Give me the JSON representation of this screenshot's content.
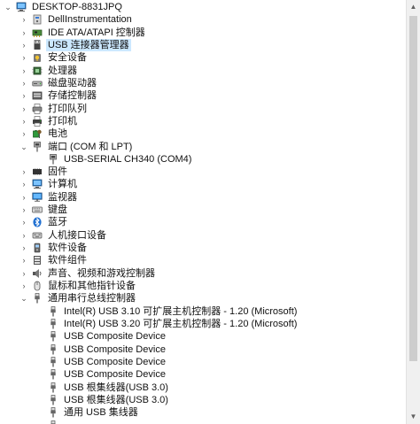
{
  "computer": "DESKTOP-8831JPQ",
  "rows": [
    {
      "label": "DESKTOP-8831JPQ",
      "level": 0,
      "expander": "expanded",
      "icon": "computer-icon"
    },
    {
      "label": "DellInstrumentation",
      "level": 1,
      "expander": "collapsed",
      "icon": "device-icon"
    },
    {
      "label": "IDE ATA/ATAPI 控制器",
      "level": 1,
      "expander": "collapsed",
      "icon": "ide-controller-icon"
    },
    {
      "label": "USB 连接器管理器",
      "level": 1,
      "expander": "collapsed",
      "icon": "usb-connector-icon",
      "selected": true
    },
    {
      "label": "安全设备",
      "level": 1,
      "expander": "collapsed",
      "icon": "security-device-icon"
    },
    {
      "label": "处理器",
      "level": 1,
      "expander": "collapsed",
      "icon": "processor-icon"
    },
    {
      "label": "磁盘驱动器",
      "level": 1,
      "expander": "collapsed",
      "icon": "disk-drive-icon"
    },
    {
      "label": "存储控制器",
      "level": 1,
      "expander": "collapsed",
      "icon": "storage-controller-icon"
    },
    {
      "label": "打印队列",
      "level": 1,
      "expander": "collapsed",
      "icon": "print-queue-icon"
    },
    {
      "label": "打印机",
      "level": 1,
      "expander": "collapsed",
      "icon": "printer-icon"
    },
    {
      "label": "电池",
      "level": 1,
      "expander": "collapsed",
      "icon": "battery-icon"
    },
    {
      "label": "端口 (COM 和 LPT)",
      "level": 1,
      "expander": "expanded",
      "icon": "port-icon"
    },
    {
      "label": "USB-SERIAL CH340 (COM4)",
      "level": 2,
      "expander": "none",
      "icon": "port-icon"
    },
    {
      "label": "固件",
      "level": 1,
      "expander": "collapsed",
      "icon": "firmware-icon"
    },
    {
      "label": "计算机",
      "level": 1,
      "expander": "collapsed",
      "icon": "computer-icon"
    },
    {
      "label": "监视器",
      "level": 1,
      "expander": "collapsed",
      "icon": "monitor-icon"
    },
    {
      "label": "键盘",
      "level": 1,
      "expander": "collapsed",
      "icon": "keyboard-icon"
    },
    {
      "label": "蓝牙",
      "level": 1,
      "expander": "collapsed",
      "icon": "bluetooth-icon"
    },
    {
      "label": "人机接口设备",
      "level": 1,
      "expander": "collapsed",
      "icon": "hid-icon"
    },
    {
      "label": "软件设备",
      "level": 1,
      "expander": "collapsed",
      "icon": "software-device-icon"
    },
    {
      "label": "软件组件",
      "level": 1,
      "expander": "collapsed",
      "icon": "software-component-icon"
    },
    {
      "label": "声音、视频和游戏控制器",
      "level": 1,
      "expander": "collapsed",
      "icon": "sound-icon"
    },
    {
      "label": "鼠标和其他指针设备",
      "level": 1,
      "expander": "collapsed",
      "icon": "mouse-icon"
    },
    {
      "label": "通用串行总线控制器",
      "level": 1,
      "expander": "expanded",
      "icon": "usb-controller-icon"
    },
    {
      "label": "Intel(R) USB 3.10 可扩展主机控制器 - 1.20 (Microsoft)",
      "level": 2,
      "expander": "none",
      "icon": "usb-device-icon"
    },
    {
      "label": "Intel(R) USB 3.20 可扩展主机控制器 - 1.20 (Microsoft)",
      "level": 2,
      "expander": "none",
      "icon": "usb-device-icon"
    },
    {
      "label": "USB Composite Device",
      "level": 2,
      "expander": "none",
      "icon": "usb-device-icon"
    },
    {
      "label": "USB Composite Device",
      "level": 2,
      "expander": "none",
      "icon": "usb-device-icon"
    },
    {
      "label": "USB Composite Device",
      "level": 2,
      "expander": "none",
      "icon": "usb-device-icon"
    },
    {
      "label": "USB Composite Device",
      "level": 2,
      "expander": "none",
      "icon": "usb-device-icon"
    },
    {
      "label": "USB 根集线器(USB 3.0)",
      "level": 2,
      "expander": "none",
      "icon": "usb-device-icon"
    },
    {
      "label": "USB 根集线器(USB 3.0)",
      "level": 2,
      "expander": "none",
      "icon": "usb-device-icon"
    },
    {
      "label": "通用 USB 集线器",
      "level": 2,
      "expander": "none",
      "icon": "usb-device-icon"
    },
    {
      "label": "",
      "level": 2,
      "expander": "none",
      "icon": "usb-device-icon"
    }
  ],
  "colors": {
    "selection": "#cce8ff",
    "text": "#111111"
  }
}
